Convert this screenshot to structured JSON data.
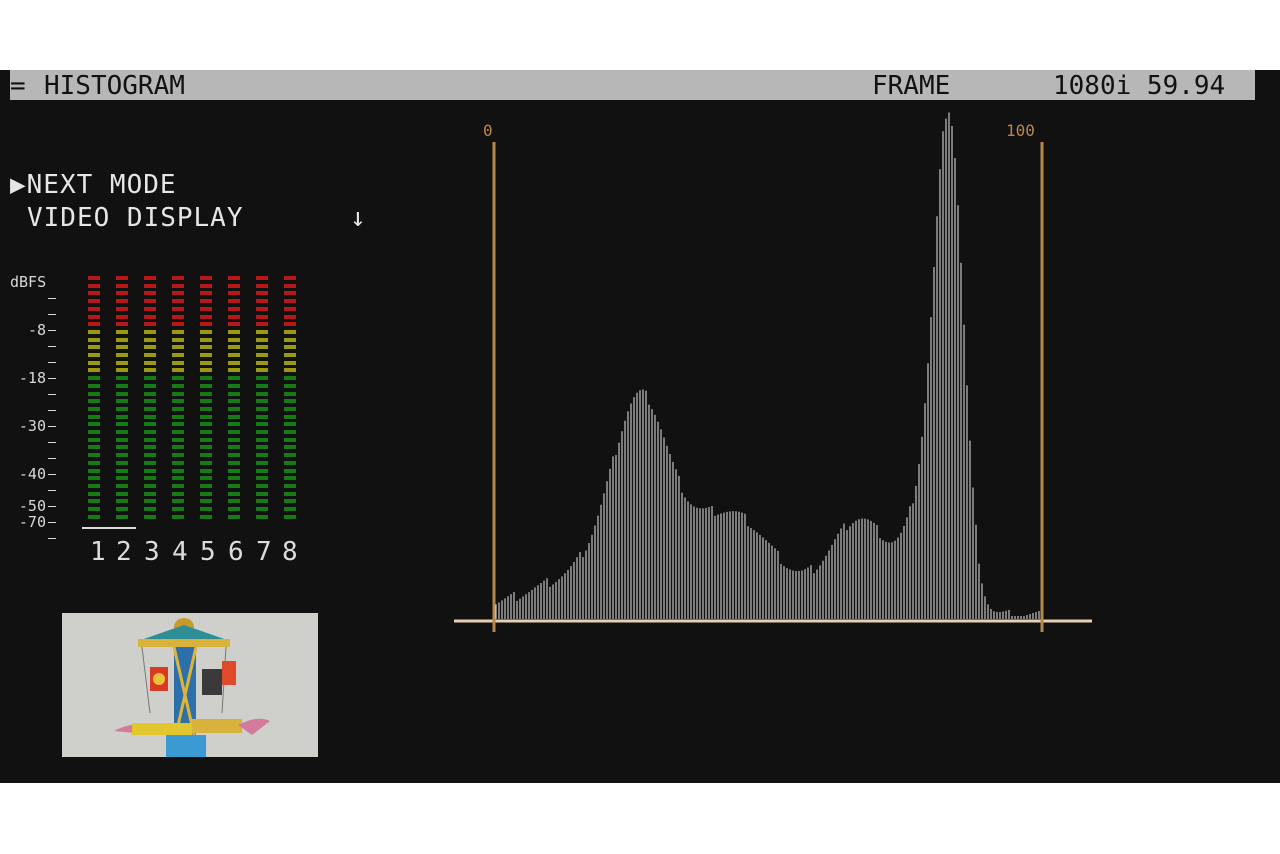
{
  "header": {
    "menu_glyph": "=",
    "title": "HISTOGRAM",
    "mode": "FRAME",
    "format": "1080i 59.94"
  },
  "menu": {
    "next_mode": "▶NEXT MODE",
    "video_display": "VIDEO DISPLAY",
    "arrow": "↓"
  },
  "audio_meter": {
    "unit": "dBFS",
    "scale_labels": [
      "-8",
      "-18",
      "-30",
      "-40",
      "-50",
      "-70"
    ],
    "channels": [
      "1",
      "2",
      "3",
      "4",
      "5",
      "6",
      "7",
      "8"
    ],
    "selected_channels": [
      "1",
      "2"
    ],
    "colors": {
      "red": "#b81818",
      "yellow": "#9a9a10",
      "green": "#167a16"
    }
  },
  "histogram": {
    "axis_min_label": "0",
    "axis_max_label": "100",
    "axis_color": "#b8874a",
    "bar_color": "#e8e8e8"
  },
  "thumbnail": {
    "description_icon": "carousel-toy-thumbnail"
  }
}
